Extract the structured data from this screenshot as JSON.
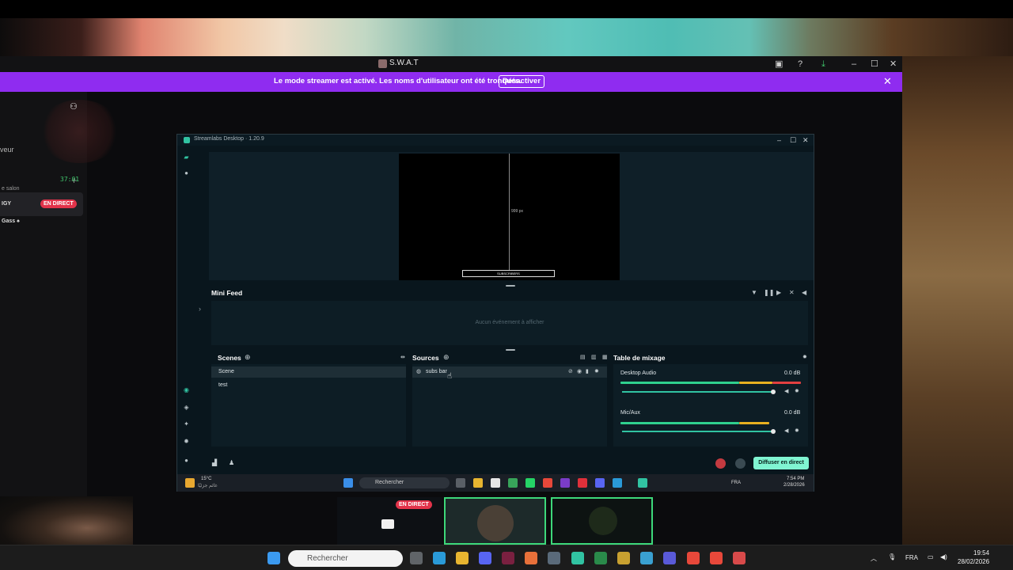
{
  "discord": {
    "window_title": "S.W.A.T",
    "banner_text": "Le mode streamer est activé. Les noms d'utilisateur ont été tronqués.",
    "banner_button": "Désactiver",
    "sidebar": {
      "partial_label": "veur",
      "voice_timer": "37:01",
      "voice_subtext": "e salon",
      "live_badge": "EN DIRECT",
      "users": [
        "IGY",
        "Gass ♠"
      ]
    }
  },
  "streamlabs": {
    "title": "Streamlabs Desktop · 1.20.9",
    "preview": {
      "guide_label": "999 px",
      "bar_text": "SUBSCRIBERS"
    },
    "mini_feed": {
      "title": "Mini Feed",
      "empty_text": "Aucun événement à afficher"
    },
    "scenes": {
      "title": "Scenes",
      "items": [
        "Scene",
        "test"
      ]
    },
    "sources": {
      "title": "Sources",
      "items": [
        "subs bar"
      ]
    },
    "mixer": {
      "title": "Table de mixage",
      "channels": [
        {
          "name": "Desktop Audio",
          "db": "0.0 dB"
        },
        {
          "name": "Mic/Aux",
          "db": "0.0 dB"
        }
      ]
    },
    "go_live": "Diffuser en direct"
  },
  "inner_taskbar": {
    "weather_temp": "15°C",
    "weather_desc": "غائم جزئيًا",
    "search": "Rechercher",
    "lang": "FRA",
    "time": "7:54 PM",
    "date": "2/28/2026"
  },
  "thumbnails": {
    "live_badge": "EN DIRECT"
  },
  "windows_taskbar": {
    "search": "Rechercher",
    "lang": "FRA",
    "time": "19:54",
    "date": "28/02/2026"
  },
  "colors": {
    "banner": "#8f2cf0",
    "streamlabs_accent": "#80f5d2",
    "live": "#e2334a"
  }
}
